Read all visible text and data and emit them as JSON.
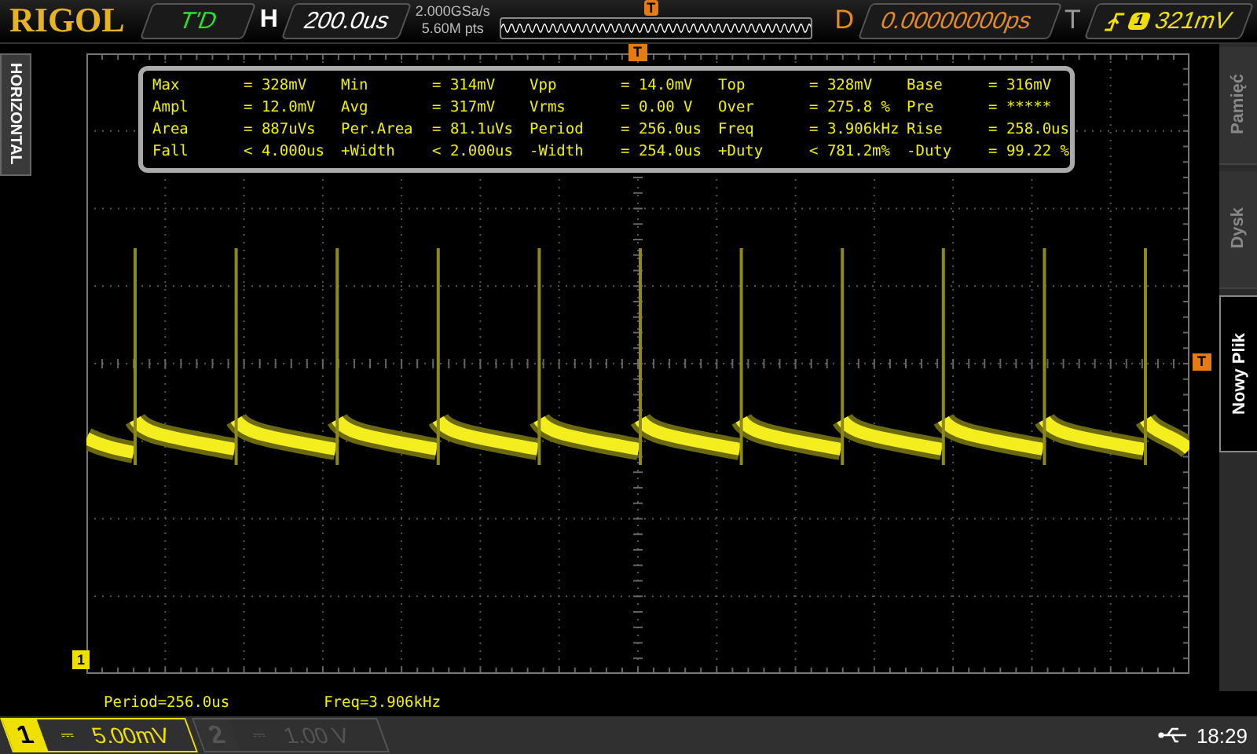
{
  "top_bar": {
    "brand": "RIGOL",
    "run_status": "T'D",
    "timebase": {
      "label": "H",
      "value": "200.0us"
    },
    "sample_rate": "2.000GSa/s",
    "memory_depth": "5.60M pts",
    "delay": {
      "label": "D",
      "value": "0.00000000ps"
    },
    "trigger": {
      "label": "T",
      "source": "1",
      "level": "321mV"
    }
  },
  "side_label": "HORIZONTAL",
  "markers": {
    "overview_trigger": "T",
    "trigger_position": "T",
    "trigger_level": "T",
    "channel": "1"
  },
  "measurements": [
    [
      {
        "name": "Max",
        "value": "= 328mV"
      },
      {
        "name": "Min",
        "value": "= 314mV"
      },
      {
        "name": "Vpp",
        "value": "= 14.0mV"
      },
      {
        "name": "Top",
        "value": "= 328mV"
      },
      {
        "name": "Base",
        "value": "= 316mV"
      }
    ],
    [
      {
        "name": "Ampl",
        "value": "= 12.0mV"
      },
      {
        "name": "Avg",
        "value": "= 317mV"
      },
      {
        "name": "Vrms",
        "value": "= 0.00 V"
      },
      {
        "name": "Over",
        "value": "= 275.8 %"
      },
      {
        "name": "Pre",
        "value": "= *****"
      }
    ],
    [
      {
        "name": "Area",
        "value": "= 887uVs"
      },
      {
        "name": "Per.Area",
        "value": "= 81.1uVs"
      },
      {
        "name": "Period",
        "value": "= 256.0us"
      },
      {
        "name": "Freq",
        "value": "= 3.906kHz"
      },
      {
        "name": "Rise",
        "value": "= 258.0us"
      }
    ],
    [
      {
        "name": "Fall",
        "value": "< 4.000us"
      },
      {
        "name": "+Width",
        "value": "< 2.000us"
      },
      {
        "name": "-Width",
        "value": "= 254.0us"
      },
      {
        "name": "+Duty",
        "value": "< 781.2m%"
      },
      {
        "name": "-Duty",
        "value": "= 99.22 %"
      }
    ]
  ],
  "readouts": [
    "Period=256.0us",
    "Freq=3.906kHz"
  ],
  "menu": [
    {
      "label": "Pamięć",
      "selected": false
    },
    {
      "label": "Dysk",
      "selected": false
    },
    {
      "label": "Nowy Plik",
      "selected": true
    }
  ],
  "channels": [
    {
      "number": "1",
      "coupling": "⎓",
      "scale": "5.00mV",
      "enabled": true
    },
    {
      "number": "2",
      "coupling": "⎓",
      "scale": "1.00 V",
      "enabled": false
    }
  ],
  "status": {
    "time": "18:29"
  }
}
